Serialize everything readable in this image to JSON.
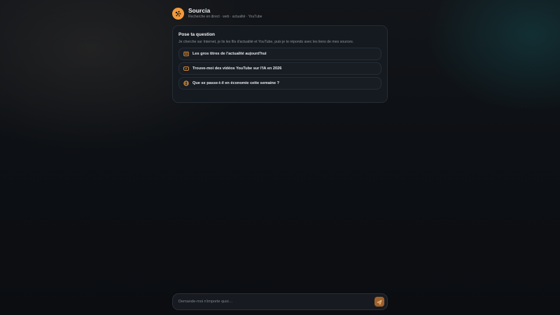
{
  "app": {
    "name": "Sourcia",
    "tagline": "Recherche en direct · web · actualité · YouTube",
    "logo_icon": "sparkle-dots-icon",
    "accent_color": "#f29a3d"
  },
  "intro": {
    "title": "Pose ta question",
    "description": "Je cherche sur Internet, je lis les fils d'actualité et YouTube, puis je te réponds avec les liens de mes sources."
  },
  "suggestions": [
    {
      "icon": "newspaper-icon",
      "label": "Les gros titres de l'actualité aujourd'hui"
    },
    {
      "icon": "video-icon",
      "label": "Trouve-moi des vidéos YouTube sur l'IA en 2026"
    },
    {
      "icon": "globe-icon",
      "label": "Que se passe-t-il en économie cette semaine ?"
    }
  ],
  "composer": {
    "placeholder": "Demande-moi n'importe quoi…",
    "value": "",
    "send_icon": "send-icon"
  }
}
